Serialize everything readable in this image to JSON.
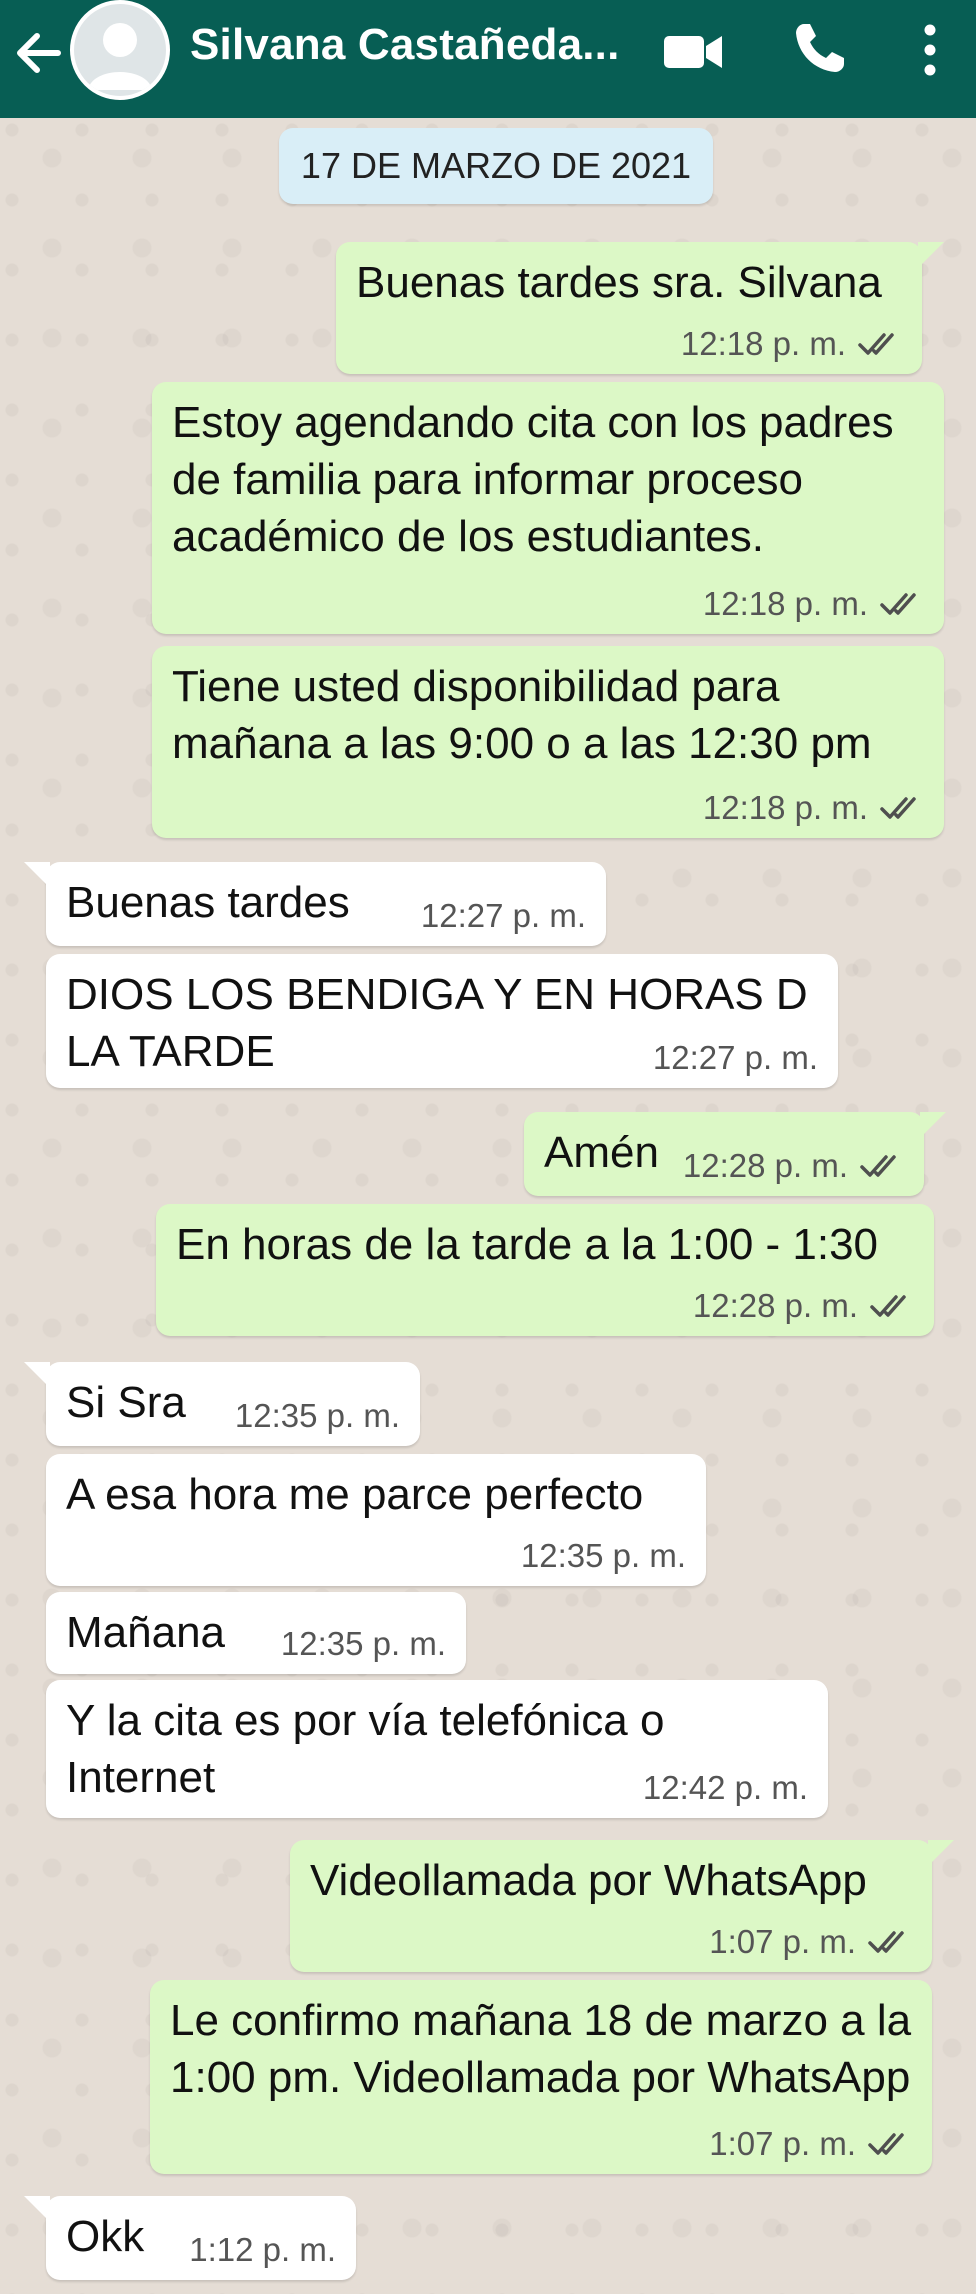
{
  "header": {
    "contact_name": "Silvana Castañeda...",
    "back_icon": "arrow-left-icon",
    "video_icon": "video-camera-icon",
    "call_icon": "phone-icon",
    "menu_icon": "more-vertical-icon",
    "bg_color": "#075e54"
  },
  "date_chip": "17 DE MARZO DE 2021",
  "messages": [
    {
      "dir": "out",
      "text": "Buenas tardes sra. Silvana",
      "time": "12:18 p. m."
    },
    {
      "dir": "out",
      "text": "Estoy agendando cita con los padres de familia para informar proceso académico de los estudiantes.",
      "time": "12:18 p. m."
    },
    {
      "dir": "out",
      "text": "Tiene usted disponibilidad para mañana a las 9:00 o a las 12:30 pm",
      "time": "12:18 p. m."
    },
    {
      "dir": "in",
      "text": "Buenas tardes",
      "time": "12:27 p. m."
    },
    {
      "dir": "in",
      "text": "DIOS LOS BENDIGA Y EN HORAS D LA TARDE",
      "time": "12:27 p. m."
    },
    {
      "dir": "out",
      "text": "Amén",
      "time": "12:28 p. m."
    },
    {
      "dir": "out",
      "text": "En horas de la tarde a la 1:00 - 1:30",
      "time": "12:28 p. m."
    },
    {
      "dir": "in",
      "text": "Si Sra",
      "time": "12:35 p. m."
    },
    {
      "dir": "in",
      "text": "A esa hora me parce perfecto",
      "time": "12:35 p. m."
    },
    {
      "dir": "in",
      "text": "Mañana",
      "time": "12:35 p. m."
    },
    {
      "dir": "in",
      "text": "Y la cita es por vía telefónica o Internet",
      "time": "12:42 p. m."
    },
    {
      "dir": "out",
      "text": "Videollamada por WhatsApp",
      "time": "1:07 p. m."
    },
    {
      "dir": "out",
      "text": "Le confirmo mañana 18 de marzo a la 1:00 pm. Videollamada por WhatsApp",
      "time": "1:07 p. m."
    },
    {
      "dir": "in",
      "text": "Okk",
      "time": "1:12 p. m."
    }
  ],
  "colors": {
    "outgoing_bubble": "#dcf8c6",
    "incoming_bubble": "#ffffff",
    "read_ticks": "#4f4f4f",
    "chat_background": "#e5ddd5"
  }
}
